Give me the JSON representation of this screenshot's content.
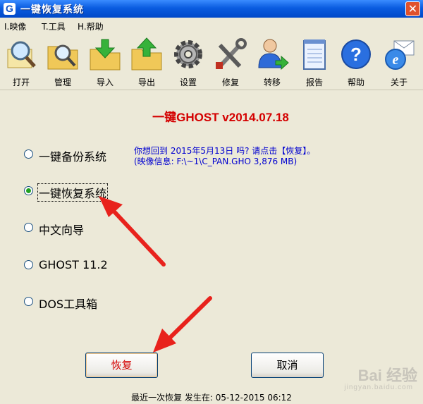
{
  "window": {
    "title": "一键恢复系统",
    "app_icon": "G",
    "close": "✕"
  },
  "menu": [
    {
      "label": "I.映像"
    },
    {
      "label": "T.工具"
    },
    {
      "label": "H.帮助"
    }
  ],
  "toolbar": [
    {
      "label": "打开",
      "icon": "magnifier-open-icon"
    },
    {
      "label": "管理",
      "icon": "folder-search-icon"
    },
    {
      "label": "导入",
      "icon": "folder-import-icon"
    },
    {
      "label": "导出",
      "icon": "folder-export-icon"
    },
    {
      "label": "设置",
      "icon": "gear-icon"
    },
    {
      "label": "修复",
      "icon": "tools-icon"
    },
    {
      "label": "转移",
      "icon": "user-transfer-icon"
    },
    {
      "label": "报告",
      "icon": "notepad-icon"
    },
    {
      "label": "帮助",
      "icon": "help-icon"
    },
    {
      "label": "关于",
      "icon": "ie-mail-icon"
    }
  ],
  "heading": "一键GHOST v2014.07.18",
  "options": [
    {
      "label": "一键备份系统",
      "selected": false
    },
    {
      "label": "一键恢复系统",
      "selected": true
    },
    {
      "label": "中文向导",
      "selected": false
    },
    {
      "label": "GHOST 11.2",
      "selected": false
    },
    {
      "label": "DOS工具箱",
      "selected": false
    }
  ],
  "info": {
    "line1": "你想回到 2015年5月13日 吗? 请点击【恢复】。",
    "line2": "(映像信息: F:\\~1\\C_PAN.GHO   3,876 MB)"
  },
  "buttons": {
    "restore": "恢复",
    "cancel": "取消"
  },
  "status": "最近一次恢复 发生在: 05-12-2015  06:12",
  "watermark": {
    "text": "Bai 经验",
    "sub": "jingyan.baidu.com"
  },
  "colors": {
    "heading": "#d40000",
    "info": "#0000d0",
    "annotation_arrow": "#e8221c",
    "titlebar": "#0a5ce0"
  }
}
